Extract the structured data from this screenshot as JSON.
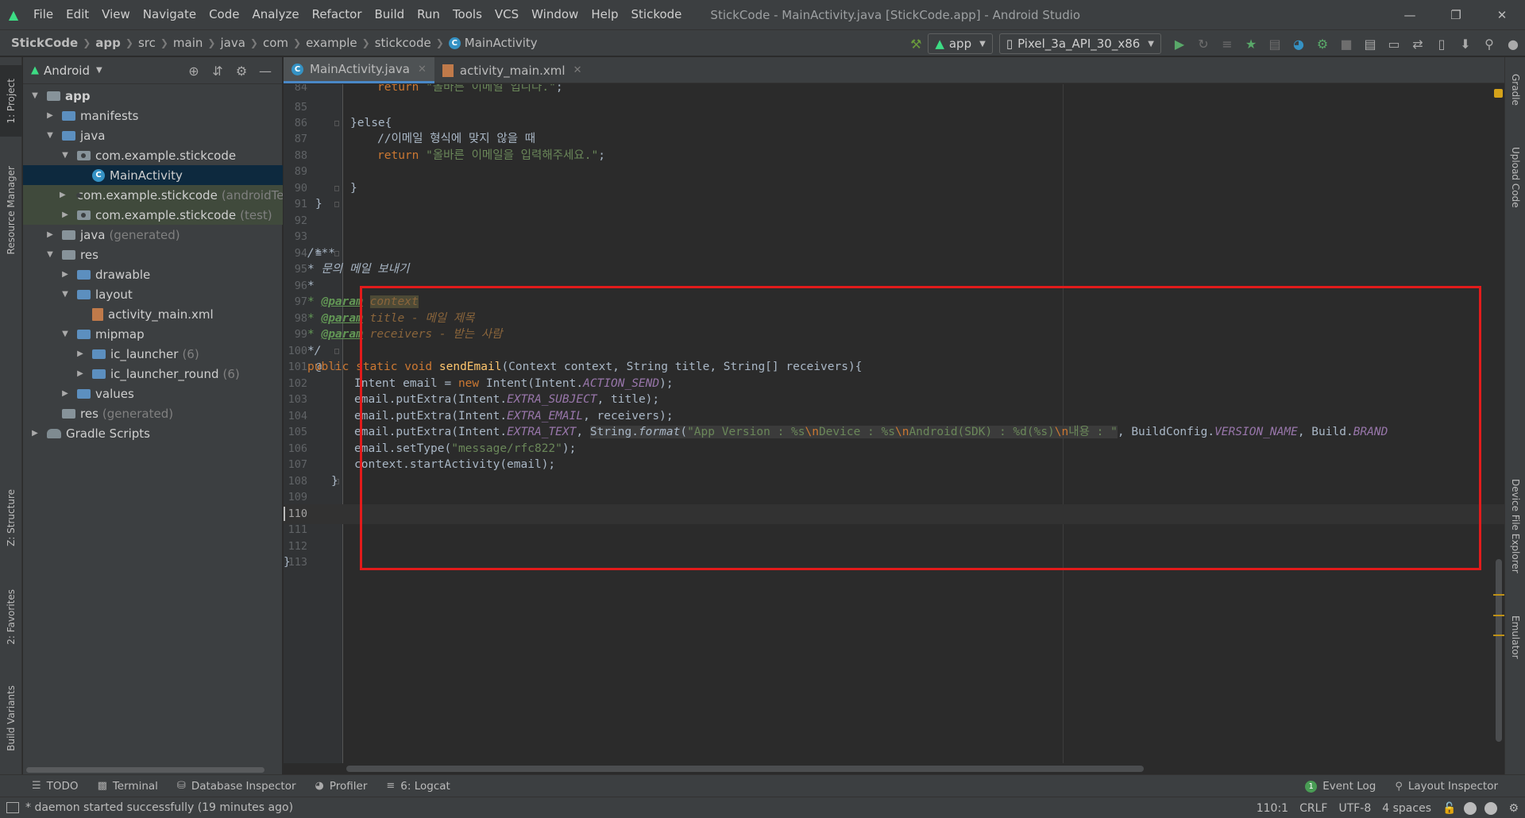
{
  "window": {
    "title": "StickCode - MainActivity.java [StickCode.app] - Android Studio",
    "minimize": "—",
    "restore": "❐",
    "close": "✕"
  },
  "menu": [
    "File",
    "Edit",
    "View",
    "Navigate",
    "Code",
    "Analyze",
    "Refactor",
    "Build",
    "Run",
    "Tools",
    "VCS",
    "Window",
    "Help",
    "Stickode"
  ],
  "breadcrumb": [
    "StickCode",
    "app",
    "src",
    "main",
    "java",
    "com",
    "example",
    "stickcode",
    "MainActivity"
  ],
  "run_config": {
    "module": "app",
    "device": "Pixel_3a_API_30_x86"
  },
  "project_panel": {
    "view_label": "Android",
    "tree": [
      {
        "depth": 0,
        "label": "app",
        "expanded": true,
        "icon": "module-folder-icon"
      },
      {
        "depth": 1,
        "label": "manifests",
        "expanded": false,
        "icon": "folder-icon"
      },
      {
        "depth": 1,
        "label": "java",
        "expanded": true,
        "icon": "folder-icon"
      },
      {
        "depth": 2,
        "label": "com.example.stickcode",
        "expanded": true,
        "icon": "package-icon"
      },
      {
        "depth": 3,
        "label": "MainActivity",
        "icon": "class-icon",
        "selected": true
      },
      {
        "depth": 2,
        "label": "com.example.stickcode",
        "suffix": "(androidTest)",
        "expanded": false,
        "icon": "package-icon",
        "tinted": true
      },
      {
        "depth": 2,
        "label": "com.example.stickcode",
        "suffix": "(test)",
        "expanded": false,
        "icon": "package-icon",
        "tinted": true
      },
      {
        "depth": 1,
        "label": "java",
        "suffix": "(generated)",
        "expanded": false,
        "icon": "generated-folder-icon"
      },
      {
        "depth": 1,
        "label": "res",
        "expanded": true,
        "icon": "res-folder-icon"
      },
      {
        "depth": 2,
        "label": "drawable",
        "expanded": false,
        "icon": "folder-icon"
      },
      {
        "depth": 2,
        "label": "layout",
        "expanded": true,
        "icon": "folder-icon"
      },
      {
        "depth": 3,
        "label": "activity_main.xml",
        "icon": "xml-file-icon"
      },
      {
        "depth": 2,
        "label": "mipmap",
        "expanded": true,
        "icon": "folder-icon"
      },
      {
        "depth": 3,
        "label": "ic_launcher",
        "suffix": "(6)",
        "expanded": false,
        "icon": "folder-icon"
      },
      {
        "depth": 3,
        "label": "ic_launcher_round",
        "suffix": "(6)",
        "expanded": false,
        "icon": "folder-icon"
      },
      {
        "depth": 2,
        "label": "values",
        "expanded": false,
        "icon": "folder-icon"
      },
      {
        "depth": 1,
        "label": "res",
        "suffix": "(generated)",
        "icon": "res-folder-icon"
      },
      {
        "depth": 0,
        "label": "Gradle Scripts",
        "expanded": false,
        "icon": "gradle-icon"
      }
    ]
  },
  "left_stripe": [
    "1: Project",
    "Resource Manager",
    "Z: Structure",
    "2: Favorites",
    "Build Variants"
  ],
  "right_stripe": [
    "Gradle",
    "Upload Code",
    "Device File Explorer",
    "Emulator"
  ],
  "editor_tabs": [
    {
      "label": "MainActivity.java",
      "active": true,
      "icon": "class-icon"
    },
    {
      "label": "activity_main.xml",
      "active": false,
      "icon": "xml-file-icon"
    }
  ],
  "code_lines": [
    {
      "n": "84"
    },
    {
      "n": "85"
    },
    {
      "n": "86"
    },
    {
      "n": "87"
    },
    {
      "n": "88"
    },
    {
      "n": "89"
    },
    {
      "n": "90"
    },
    {
      "n": "91"
    },
    {
      "n": "92"
    },
    {
      "n": "93"
    },
    {
      "n": "94"
    },
    {
      "n": "95"
    },
    {
      "n": "96"
    },
    {
      "n": "97"
    },
    {
      "n": "98"
    },
    {
      "n": "99"
    },
    {
      "n": "100"
    },
    {
      "n": "101"
    },
    {
      "n": "102"
    },
    {
      "n": "103"
    },
    {
      "n": "104"
    },
    {
      "n": "105"
    },
    {
      "n": "106"
    },
    {
      "n": "107"
    },
    {
      "n": "108"
    },
    {
      "n": "109"
    },
    {
      "n": "110"
    },
    {
      "n": "111"
    },
    {
      "n": "112"
    },
    {
      "n": "113"
    }
  ],
  "code": {
    "l84_return": "return ",
    "l84_str": "\"올바른 이메일 입니다.\"",
    "l86": "}else{",
    "l87": "//이메일 형식에 맞지 않을 때",
    "l88_return": "return ",
    "l88_str": "\"올바른 이메일을 입력해주세요.\"",
    "l90": "}",
    "l91": "}",
    "l94": "/***",
    "l95": "* 문의 메일 보내기",
    "l96": "*",
    "l97_star": "* ",
    "l97_tag": "@param",
    "l97_param": "context",
    "l98_star": "* ",
    "l98_tag": "@param",
    "l98_param": "title - 메일 제목",
    "l99_star": "* ",
    "l99_tag": "@param",
    "l99_param": "receivers - 받는 사람",
    "l100": "*/",
    "l101_kw": "public static void ",
    "l101_fn": "sendEmail",
    "l101_rest": "(Context context, String title, String[] receivers){",
    "l102_a": "Intent email = ",
    "l102_new": "new ",
    "l102_b": "Intent(Intent.",
    "l102_field": "ACTION_SEND",
    "l102_c": ");",
    "l103_a": "email.putExtra(Intent.",
    "l103_field": "EXTRA_SUBJECT",
    "l103_b": ", title);",
    "l104_a": "email.putExtra(Intent.",
    "l104_field": "EXTRA_EMAIL",
    "l104_b": ", receivers);",
    "l105_a": "email.putExtra(Intent.",
    "l105_field": "EXTRA_TEXT",
    "l105_b": ", ",
    "l105_c": "String.",
    "l105_fmt": "format",
    "l105_d": "(",
    "l105_s1": "\"App Version : %s",
    "l105_e1": "\\n",
    "l105_s2": "Device : %s",
    "l105_e2": "\\n",
    "l105_s3": "Android(SDK) : %d(%s)",
    "l105_e3": "\\n",
    "l105_s4": "내용 : \"",
    "l105_e": ", BuildConfig.",
    "l105_field2": "VERSION_NAME",
    "l105_f": ", Build.",
    "l105_field3": "BRAND",
    "l106_a": "email.setType(",
    "l106_str": "\"message/rfc822\"",
    "l106_b": ");",
    "l107": "context.startActivity(email);",
    "l108": "}",
    "l113": "}"
  },
  "bottom_tools_left": [
    {
      "label": "TODO",
      "icon": "list-icon"
    },
    {
      "label": "Terminal",
      "icon": "terminal-icon"
    },
    {
      "label": "Database Inspector",
      "icon": "database-icon"
    },
    {
      "label": "Profiler",
      "icon": "profiler-icon"
    },
    {
      "label": "6: Logcat",
      "icon": "logcat-icon"
    }
  ],
  "bottom_tools_right": [
    {
      "label": "Event Log",
      "icon": "event-log-icon",
      "badge": "1"
    },
    {
      "label": "Layout Inspector",
      "icon": "layout-inspector-icon"
    }
  ],
  "status": {
    "message": "* daemon started successfully (19 minutes ago)",
    "position": "110:1",
    "line_sep": "CRLF",
    "encoding": "UTF-8",
    "indent": "4 spaces"
  },
  "colors": {
    "accent": "#4a88c7",
    "highlight_box": "#e21b1b",
    "keyword": "#cc7832",
    "string": "#6a8759"
  }
}
